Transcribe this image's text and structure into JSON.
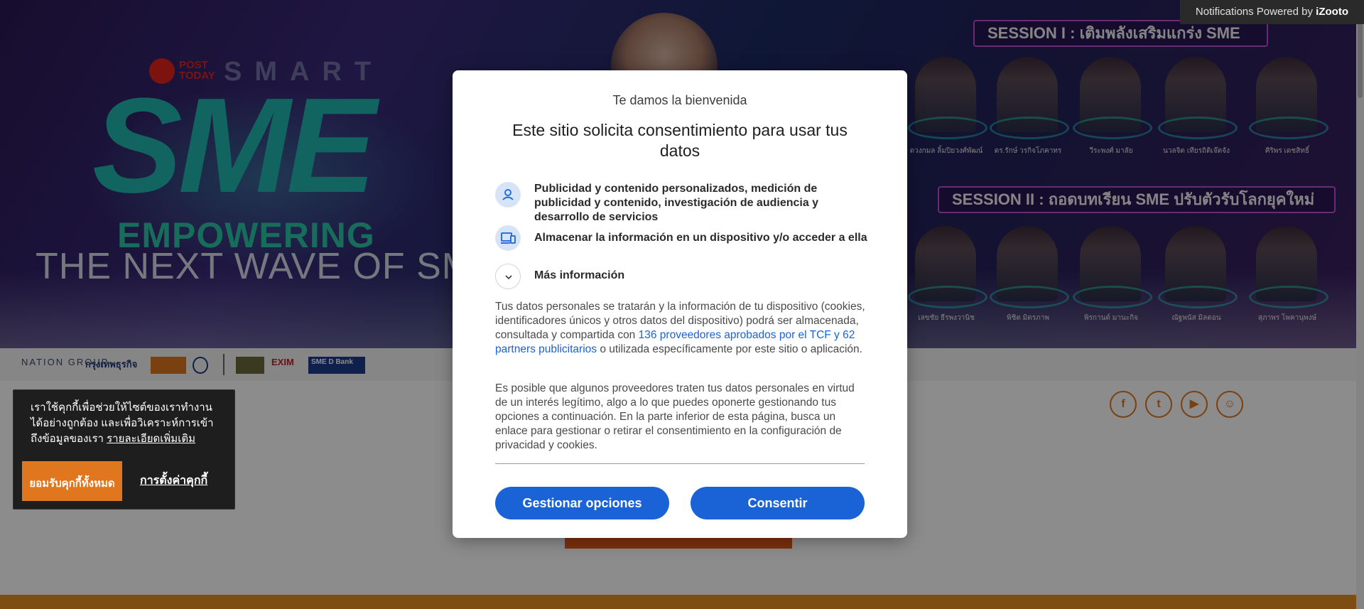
{
  "notification_badge": {
    "prefix": "Notifications Powered by ",
    "brand": "iZooto"
  },
  "banner": {
    "posttoday": "POST TODAY",
    "smart": "SMART",
    "sme": "SME",
    "empowering": "EMPOWERING",
    "next_wave": "THE NEXT WAVE OF SM",
    "session1": "SESSION I : เติมพลังเสริมแกร่ง SME",
    "session2": "SESSION II : ถอดบทเรียน SME ปรับตัวรับโลกยุคใหม่",
    "speakers_row1": [
      "ดวงกมล ลิ้มปิยวงศ์พัฒน์",
      "ดร.รักษ์ วรกิจโภคาทร",
      "วีระพงศ์ มาลัย",
      "นวลจิต เทียรถิติเจ๊ตจัง",
      "ศิริพร เดชสิทธิ์"
    ],
    "speakers_row2": [
      "เลขชัย ธีรพงวานิช",
      "พิชิต มิตรภาพ",
      "พิรกานต์ มานะกิจ",
      "ณัฐพนัส มิลดอน",
      "สุภาพร โพคานุพงษ์"
    ]
  },
  "partners": {
    "nation": "NATION GROUP",
    "krungthep": "กรุงเทพธุรกิจ",
    "exim": "EXIM",
    "smed": "SME D Bank"
  },
  "social": [
    "f",
    "t",
    "▶",
    "☺"
  ],
  "cookie_banner": {
    "text": "เราใช้คุกกี้เพื่อช่วยให้ไซต์ของเราทำงานได้อย่างถูกต้อง และเพื่อวิเคราะห์การเข้าถึงข้อมูลของเรา ",
    "link": "รายละเอียดเพิ่มเติม",
    "accept_button": "ยอมรับคุกกี้ทั้งหมด",
    "settings_link": "การตั้งค่าคุกกี้"
  },
  "consent_dialog": {
    "welcome": "Te damos la bienvenida",
    "title": "Este sitio solicita consentimiento para usar tus datos",
    "items": [
      {
        "icon": "person-icon",
        "text": "Publicidad y contenido personalizados, medición de publicidad y contenido, investigación de audiencia y desarrollo de servicios"
      },
      {
        "icon": "devices-icon",
        "text": "Almacenar la información en un dispositivo y/o acceder a ella"
      }
    ],
    "more_info": "Más información",
    "para1_start": "Tus datos personales se tratarán y la información de tu dispositivo (cookies, identificadores únicos y otros datos del dispositivo) podrá ser almacenada, consultada y compartida con ",
    "para1_link": "136 proveedores aprobados por el TCF y 62 partners publicitarios",
    "para1_end": " o utilizada específicamente por este sitio o aplicación.",
    "para2": "Es posible que algunos proveedores traten tus datos personales en virtud de un interés legítimo, algo a lo que puedes oponerte gestionando tus opciones a continuación. En la parte inferior de esta página, busca un enlace para gestionar o retirar el consentimiento en la configuración de privacidad y cookies.",
    "manage_button": "Gestionar opciones",
    "consent_button": "Consentir",
    "accent_color": "#1a63d6"
  }
}
